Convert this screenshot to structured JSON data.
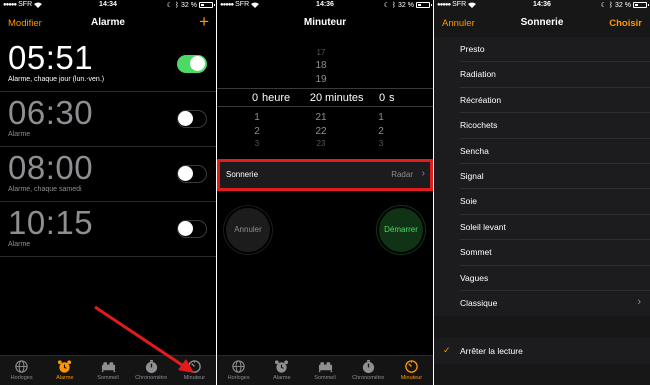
{
  "phone1": {
    "status": {
      "carrier": "SFR",
      "time": "14:34",
      "battery": "32 %"
    },
    "nav": {
      "left": "Modifier",
      "title": "Alarme",
      "right": "+"
    },
    "alarms": [
      {
        "time": "05:51",
        "label": "Alarme, chaque jour (lun.-ven.)",
        "on": true
      },
      {
        "time": "06:30",
        "label": "Alarme",
        "on": false
      },
      {
        "time": "08:00",
        "label": "Alarme, chaque samedi",
        "on": false
      },
      {
        "time": "10:15",
        "label": "Alarme",
        "on": false
      }
    ],
    "tabs": [
      "Horloges",
      "Alarme",
      "Sommeil",
      "Chronomètre",
      "Minuteur"
    ],
    "active_tab": "Alarme"
  },
  "phone2": {
    "status": {
      "carrier": "SFR",
      "time": "14:36",
      "battery": "32 %"
    },
    "nav": {
      "title": "Minuteur"
    },
    "picker": {
      "hours_above": [
        "17",
        "18",
        "19"
      ],
      "hours_selected": "0",
      "hours_label": "heure",
      "minutes_selected": "20",
      "minutes_label": "minutes",
      "seconds_selected": "0",
      "seconds_label": "s",
      "below": [
        "1",
        "2",
        "3"
      ],
      "minutes_below": [
        "21",
        "22",
        "23"
      ]
    },
    "sonnerie": {
      "label": "Sonnerie",
      "value": "Radar"
    },
    "cancel": "Annuler",
    "start": "Démarrer",
    "tabs": [
      "Horloges",
      "Alarme",
      "Sommeil",
      "Chronomètre",
      "Minuteur"
    ],
    "active_tab": "Minuteur"
  },
  "phone3": {
    "status": {
      "carrier": "SFR",
      "time": "14:36",
      "battery": "32 %"
    },
    "nav": {
      "left": "Annuler",
      "title": "Sonnerie",
      "right": "Choisir"
    },
    "ringtones": [
      "Presto",
      "Radiation",
      "Récréation",
      "Ricochets",
      "Sencha",
      "Signal",
      "Soie",
      "Soleil levant",
      "Sommet",
      "Vagues",
      "Classique"
    ],
    "stop": "Arrêter la lecture"
  },
  "colors": {
    "accent": "#ff9500",
    "green": "#4cd964",
    "highlight": "#e21b1b"
  }
}
